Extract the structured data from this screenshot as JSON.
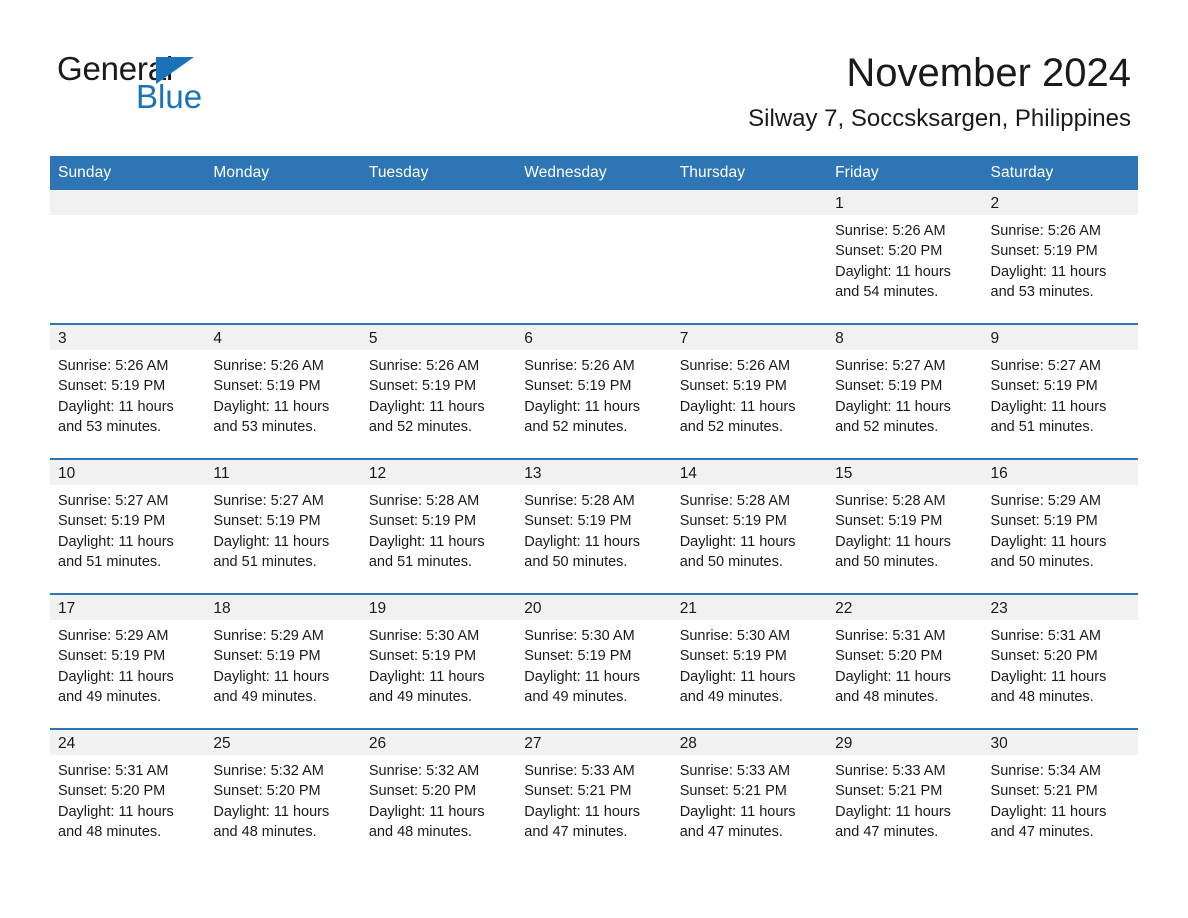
{
  "brand": {
    "name_part1": "General",
    "name_part2": "Blue",
    "triangle_color": "#1a72b8",
    "blue_text_color": "#1a72b8"
  },
  "header": {
    "month_title": "November 2024",
    "location": "Silway 7, Soccsksargen, Philippines"
  },
  "theme": {
    "header_blue": "#2e75b6",
    "row_divider_blue": "#2e75b6",
    "daynum_band_gray": "#f1f1f1",
    "text_color": "#1a1a1a"
  },
  "weekdays": [
    "Sunday",
    "Monday",
    "Tuesday",
    "Wednesday",
    "Thursday",
    "Friday",
    "Saturday"
  ],
  "weeks": [
    [
      {
        "day": "",
        "lines": []
      },
      {
        "day": "",
        "lines": []
      },
      {
        "day": "",
        "lines": []
      },
      {
        "day": "",
        "lines": []
      },
      {
        "day": "",
        "lines": []
      },
      {
        "day": "1",
        "lines": [
          "Sunrise: 5:26 AM",
          "Sunset: 5:20 PM",
          "Daylight: 11 hours",
          "and 54 minutes."
        ]
      },
      {
        "day": "2",
        "lines": [
          "Sunrise: 5:26 AM",
          "Sunset: 5:19 PM",
          "Daylight: 11 hours",
          "and 53 minutes."
        ]
      }
    ],
    [
      {
        "day": "3",
        "lines": [
          "Sunrise: 5:26 AM",
          "Sunset: 5:19 PM",
          "Daylight: 11 hours",
          "and 53 minutes."
        ]
      },
      {
        "day": "4",
        "lines": [
          "Sunrise: 5:26 AM",
          "Sunset: 5:19 PM",
          "Daylight: 11 hours",
          "and 53 minutes."
        ]
      },
      {
        "day": "5",
        "lines": [
          "Sunrise: 5:26 AM",
          "Sunset: 5:19 PM",
          "Daylight: 11 hours",
          "and 52 minutes."
        ]
      },
      {
        "day": "6",
        "lines": [
          "Sunrise: 5:26 AM",
          "Sunset: 5:19 PM",
          "Daylight: 11 hours",
          "and 52 minutes."
        ]
      },
      {
        "day": "7",
        "lines": [
          "Sunrise: 5:26 AM",
          "Sunset: 5:19 PM",
          "Daylight: 11 hours",
          "and 52 minutes."
        ]
      },
      {
        "day": "8",
        "lines": [
          "Sunrise: 5:27 AM",
          "Sunset: 5:19 PM",
          "Daylight: 11 hours",
          "and 52 minutes."
        ]
      },
      {
        "day": "9",
        "lines": [
          "Sunrise: 5:27 AM",
          "Sunset: 5:19 PM",
          "Daylight: 11 hours",
          "and 51 minutes."
        ]
      }
    ],
    [
      {
        "day": "10",
        "lines": [
          "Sunrise: 5:27 AM",
          "Sunset: 5:19 PM",
          "Daylight: 11 hours",
          "and 51 minutes."
        ]
      },
      {
        "day": "11",
        "lines": [
          "Sunrise: 5:27 AM",
          "Sunset: 5:19 PM",
          "Daylight: 11 hours",
          "and 51 minutes."
        ]
      },
      {
        "day": "12",
        "lines": [
          "Sunrise: 5:28 AM",
          "Sunset: 5:19 PM",
          "Daylight: 11 hours",
          "and 51 minutes."
        ]
      },
      {
        "day": "13",
        "lines": [
          "Sunrise: 5:28 AM",
          "Sunset: 5:19 PM",
          "Daylight: 11 hours",
          "and 50 minutes."
        ]
      },
      {
        "day": "14",
        "lines": [
          "Sunrise: 5:28 AM",
          "Sunset: 5:19 PM",
          "Daylight: 11 hours",
          "and 50 minutes."
        ]
      },
      {
        "day": "15",
        "lines": [
          "Sunrise: 5:28 AM",
          "Sunset: 5:19 PM",
          "Daylight: 11 hours",
          "and 50 minutes."
        ]
      },
      {
        "day": "16",
        "lines": [
          "Sunrise: 5:29 AM",
          "Sunset: 5:19 PM",
          "Daylight: 11 hours",
          "and 50 minutes."
        ]
      }
    ],
    [
      {
        "day": "17",
        "lines": [
          "Sunrise: 5:29 AM",
          "Sunset: 5:19 PM",
          "Daylight: 11 hours",
          "and 49 minutes."
        ]
      },
      {
        "day": "18",
        "lines": [
          "Sunrise: 5:29 AM",
          "Sunset: 5:19 PM",
          "Daylight: 11 hours",
          "and 49 minutes."
        ]
      },
      {
        "day": "19",
        "lines": [
          "Sunrise: 5:30 AM",
          "Sunset: 5:19 PM",
          "Daylight: 11 hours",
          "and 49 minutes."
        ]
      },
      {
        "day": "20",
        "lines": [
          "Sunrise: 5:30 AM",
          "Sunset: 5:19 PM",
          "Daylight: 11 hours",
          "and 49 minutes."
        ]
      },
      {
        "day": "21",
        "lines": [
          "Sunrise: 5:30 AM",
          "Sunset: 5:19 PM",
          "Daylight: 11 hours",
          "and 49 minutes."
        ]
      },
      {
        "day": "22",
        "lines": [
          "Sunrise: 5:31 AM",
          "Sunset: 5:20 PM",
          "Daylight: 11 hours",
          "and 48 minutes."
        ]
      },
      {
        "day": "23",
        "lines": [
          "Sunrise: 5:31 AM",
          "Sunset: 5:20 PM",
          "Daylight: 11 hours",
          "and 48 minutes."
        ]
      }
    ],
    [
      {
        "day": "24",
        "lines": [
          "Sunrise: 5:31 AM",
          "Sunset: 5:20 PM",
          "Daylight: 11 hours",
          "and 48 minutes."
        ]
      },
      {
        "day": "25",
        "lines": [
          "Sunrise: 5:32 AM",
          "Sunset: 5:20 PM",
          "Daylight: 11 hours",
          "and 48 minutes."
        ]
      },
      {
        "day": "26",
        "lines": [
          "Sunrise: 5:32 AM",
          "Sunset: 5:20 PM",
          "Daylight: 11 hours",
          "and 48 minutes."
        ]
      },
      {
        "day": "27",
        "lines": [
          "Sunrise: 5:33 AM",
          "Sunset: 5:21 PM",
          "Daylight: 11 hours",
          "and 47 minutes."
        ]
      },
      {
        "day": "28",
        "lines": [
          "Sunrise: 5:33 AM",
          "Sunset: 5:21 PM",
          "Daylight: 11 hours",
          "and 47 minutes."
        ]
      },
      {
        "day": "29",
        "lines": [
          "Sunrise: 5:33 AM",
          "Sunset: 5:21 PM",
          "Daylight: 11 hours",
          "and 47 minutes."
        ]
      },
      {
        "day": "30",
        "lines": [
          "Sunrise: 5:34 AM",
          "Sunset: 5:21 PM",
          "Daylight: 11 hours",
          "and 47 minutes."
        ]
      }
    ]
  ]
}
